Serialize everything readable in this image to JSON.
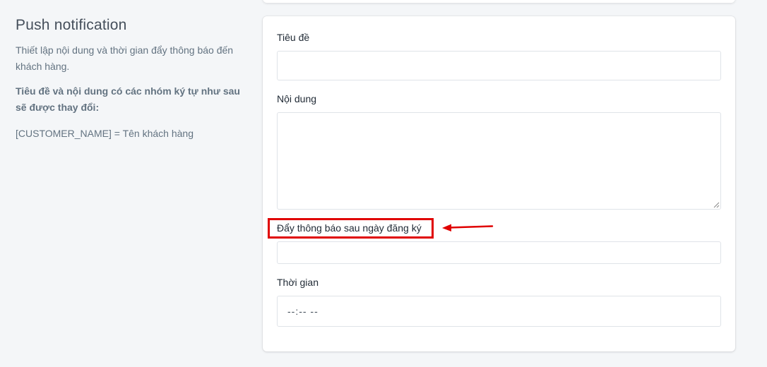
{
  "left": {
    "title": "Push notification",
    "description": "Thiết lập nội dung và thời gian đẩy thông báo đến khách hàng.",
    "note": "Tiêu đề và nội dung có các nhóm ký tự như sau sẽ được thay đổi:",
    "variable": "[CUSTOMER_NAME] = Tên khách hàng"
  },
  "form": {
    "title_label": "Tiêu đề",
    "title_value": "",
    "content_label": "Nội dung",
    "content_value": "",
    "days_label": "Đẩy thông báo sau ngày đăng ký",
    "days_value": "",
    "time_label": "Thời gian",
    "time_value": "--:-- --"
  },
  "annotation": {
    "highlight_color": "#e00000"
  }
}
